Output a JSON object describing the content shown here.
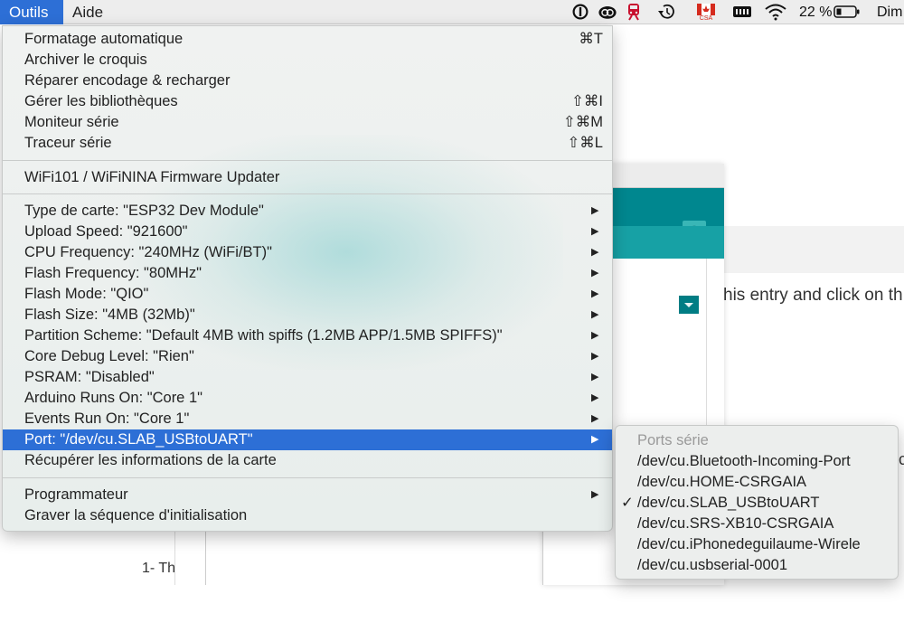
{
  "menubar": {
    "items": [
      {
        "label": "Outils",
        "active": true
      },
      {
        "label": "Aide",
        "active": false
      }
    ],
    "status": {
      "flag_label": "CSA",
      "battery_percent": "22 %",
      "clock": "Dim",
      "icons": [
        "info-icon",
        "creative-cloud-icon",
        "train-icon",
        "time-machine-icon",
        "canada-flag-icon",
        "memory-icon",
        "wifi-icon",
        "battery-icon"
      ]
    }
  },
  "tools_menu": {
    "items": [
      {
        "label": "Formatage automatique",
        "shortcut": "⌘T",
        "submenu": false
      },
      {
        "label": "Archiver le croquis",
        "shortcut": "",
        "submenu": false
      },
      {
        "label": "Réparer encodage & recharger",
        "shortcut": "",
        "submenu": false
      },
      {
        "label": "Gérer les bibliothèques",
        "shortcut": "⇧⌘I",
        "submenu": false
      },
      {
        "label": "Moniteur série",
        "shortcut": "⇧⌘M",
        "submenu": false
      },
      {
        "label": "Traceur série",
        "shortcut": "⇧⌘L",
        "submenu": false
      },
      {
        "label": "WiFi101 / WiFiNINA Firmware Updater",
        "shortcut": "",
        "submenu": false
      },
      {
        "label": "Type de carte: \"ESP32 Dev Module\"",
        "shortcut": "",
        "submenu": true
      },
      {
        "label": "Upload Speed: \"921600\"",
        "shortcut": "",
        "submenu": true
      },
      {
        "label": "CPU Frequency: \"240MHz (WiFi/BT)\"",
        "shortcut": "",
        "submenu": true
      },
      {
        "label": "Flash Frequency: \"80MHz\"",
        "shortcut": "",
        "submenu": true
      },
      {
        "label": "Flash Mode: \"QIO\"",
        "shortcut": "",
        "submenu": true
      },
      {
        "label": "Flash Size: \"4MB (32Mb)\"",
        "shortcut": "",
        "submenu": true
      },
      {
        "label": "Partition Scheme: \"Default 4MB with spiffs (1.2MB APP/1.5MB SPIFFS)\"",
        "shortcut": "",
        "submenu": true
      },
      {
        "label": "Core Debug Level: \"Rien\"",
        "shortcut": "",
        "submenu": true
      },
      {
        "label": "PSRAM: \"Disabled\"",
        "shortcut": "",
        "submenu": true
      },
      {
        "label": "Arduino Runs On: \"Core 1\"",
        "shortcut": "",
        "submenu": true
      },
      {
        "label": "Events Run On: \"Core 1\"",
        "shortcut": "",
        "submenu": true
      },
      {
        "label": "Port: \"/dev/cu.SLAB_USBtoUART\"",
        "shortcut": "",
        "submenu": true,
        "selected": true
      },
      {
        "label": "Récupérer les informations de la carte",
        "shortcut": "",
        "submenu": false
      },
      {
        "label": "Programmateur",
        "shortcut": "",
        "submenu": true
      },
      {
        "label": "Graver la séquence d'initialisation",
        "shortcut": "",
        "submenu": false
      }
    ],
    "arrow_glyph": "▶"
  },
  "port_submenu": {
    "header": "Ports série",
    "check_glyph": "✓",
    "items": [
      {
        "label": "/dev/cu.Bluetooth-Incoming-Port",
        "checked": false
      },
      {
        "label": "/dev/cu.HOME-CSRGAIA",
        "checked": false
      },
      {
        "label": "/dev/cu.SLAB_USBtoUART",
        "checked": true
      },
      {
        "label": "/dev/cu.SRS-XB10-CSRGAIA",
        "checked": false
      },
      {
        "label": "/dev/cu.iPhonedeguilaume-Wirele",
        "checked": false
      },
      {
        "label": "/dev/cu.usbserial-0001",
        "checked": false
      }
    ]
  },
  "background": {
    "page_text": "his entry and click on th",
    "bottom_text": "1- Th",
    "side_char": "c"
  },
  "colors": {
    "selection": "#2d6fd6",
    "arduino_teal_dark": "#00878f",
    "arduino_teal_light": "#17a1a5"
  }
}
